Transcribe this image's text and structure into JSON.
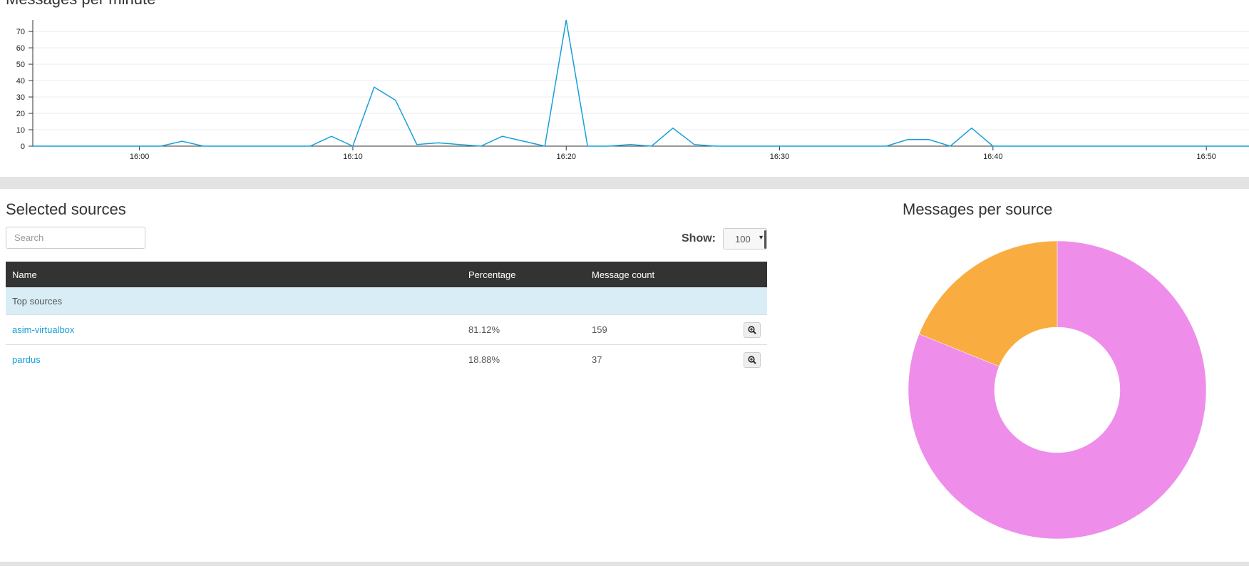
{
  "line_panel": {
    "heading": "Messages per minute"
  },
  "sources": {
    "title": "Selected sources",
    "search_placeholder": "Search",
    "show_label": "Show:",
    "show_value": "100",
    "columns": [
      "Name",
      "Percentage",
      "Message count"
    ],
    "group_label": "Top sources",
    "rows": [
      {
        "name": "asim-virtualbox",
        "percentage": "81.12%",
        "count": "159"
      },
      {
        "name": "pardus",
        "percentage": "18.88%",
        "count": "37"
      }
    ],
    "zoom_icon": "zoom-in-icon"
  },
  "pie_panel": {
    "title": "Messages per source"
  },
  "colors": {
    "line": "#16a0d8",
    "pie_major": "#ee8eea",
    "pie_minor": "#f9ad40",
    "header_bg": "#333333",
    "group_bg": "#d9edf7",
    "link": "#16a0d8"
  },
  "chart_data": [
    {
      "type": "line",
      "title": "Messages per minute",
      "x_ticks": [
        "16:00",
        "16:10",
        "16:20",
        "16:30",
        "16:40",
        "16:50"
      ],
      "y_ticks": [
        0,
        10,
        20,
        30,
        40,
        50,
        60,
        70
      ],
      "ylim": [
        0,
        77
      ],
      "xlim_minutes": [
        "15:55",
        "16:52"
      ],
      "grid": true,
      "x_minutes_after_1600": [
        -5,
        1,
        2,
        3,
        8,
        9,
        10,
        11,
        12,
        13,
        14,
        15,
        16,
        17,
        18,
        19,
        20,
        21,
        22,
        23,
        24,
        25,
        26,
        27,
        35,
        36,
        37,
        38,
        39,
        40,
        52
      ],
      "x": [
        "15:55",
        "16:01",
        "16:02",
        "16:03",
        "16:08",
        "16:09",
        "16:10",
        "16:11",
        "16:12",
        "16:13",
        "16:14",
        "16:15",
        "16:16",
        "16:17",
        "16:18",
        "16:19",
        "16:20",
        "16:21",
        "16:22",
        "16:23",
        "16:24",
        "16:25",
        "16:26",
        "16:27",
        "16:35",
        "16:36",
        "16:37",
        "16:38",
        "16:39",
        "16:40",
        "16:52"
      ],
      "values": [
        0,
        0,
        3,
        0,
        0,
        6,
        0,
        36,
        28,
        1,
        2,
        1,
        0,
        6,
        3,
        0,
        77,
        0,
        0,
        1,
        0,
        11,
        1,
        0,
        0,
        4,
        4,
        0,
        11,
        0,
        0
      ]
    },
    {
      "type": "pie",
      "title": "Messages per source",
      "labels": [
        "asim-virtualbox",
        "pardus"
      ],
      "values": [
        159,
        37
      ],
      "percentages": [
        81.12,
        18.88
      ],
      "colors": [
        "#ee8eea",
        "#f9ad40"
      ]
    }
  ]
}
